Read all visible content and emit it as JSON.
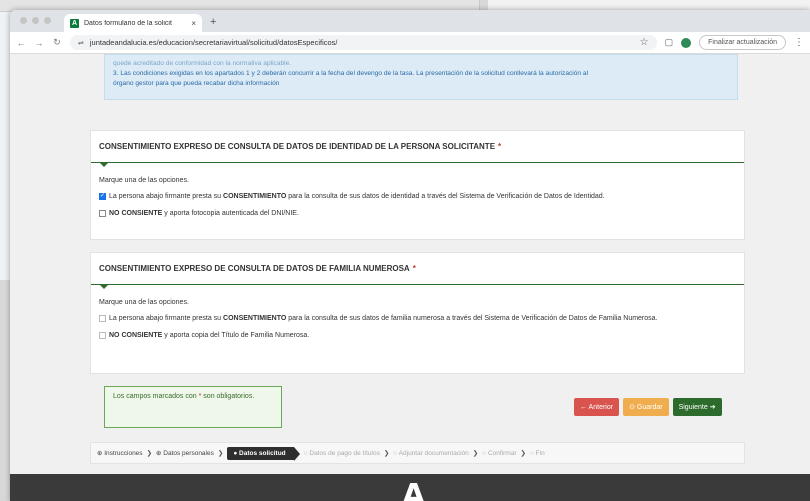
{
  "browser": {
    "tab_title": "Datos formulario de la solicit",
    "tab_close": "×",
    "new_tab": "+",
    "url": "juntadeandalucia.es/educacion/secretariavirtual/solicitud/datosEspecificos/",
    "update_button": "Finalizar actualización",
    "favicon": "A"
  },
  "info_box": {
    "line_cut": "quede acreditado de conformidad con la normativa aplicable.",
    "line_3": "3. Las condiciones exigidas en los apartados 1 y 2 deberán concurrir a la fecha del devengo de la tasa. La presentación de la solicitud conllevará la autorización al",
    "line_4": "órgano gestor para que pueda recabar dicha información"
  },
  "identity_panel": {
    "title": "CONSENTIMIENTO EXPRESO DE CONSULTA DE DATOS DE IDENTIDAD DE LA PERSONA SOLICITANTE",
    "required_mark": "*",
    "hint": "Marque una de las opciones.",
    "option_consent_pre": "La persona abajo firmante presta su",
    "option_consent_bold": "CONSENTIMIENTO",
    "option_consent_post": "para la consulta de sus datos de identidad a través del Sistema de Verificación de Datos de Identidad.",
    "option_consent_checked": true,
    "option_deny_bold": "NO CONSIENTE",
    "option_deny_post": "y aporta fotocopia autenticada del DNI/NIE."
  },
  "family_panel": {
    "title": "CONSENTIMIENTO EXPRESO DE CONSULTA DE DATOS DE FAMILIA NUMEROSA",
    "required_mark": "*",
    "hint": "Marque una de las opciones.",
    "option_consent_pre": "La persona abajo firmante presta su",
    "option_consent_bold": "CONSENTIMIENTO",
    "option_consent_post": "para la consulta de sus datos de familia numerosa a través del Sistema de Verificación de Datos de Familia Numerosa.",
    "option_deny_bold": "NO CONSIENTE",
    "option_deny_post": "y aporta copia del Título de Familia Numerosa."
  },
  "required_note": {
    "text_pre": "Los campos marcados con",
    "star": "*",
    "text_post": "son obligatorios."
  },
  "buttons": {
    "prev": "← Anterior",
    "save": "⊙ Guardar",
    "next": "Siguiente ➔"
  },
  "steps": {
    "instructions": "⊕ Instrucciones",
    "personal": "⊕ Datos personales",
    "request": "● Datos solicitud",
    "payment": "○ Datos de pago de títulos",
    "attach": "○ Adjuntar documentación",
    "confirm": "○ Confirmar",
    "end": "○ Fin",
    "separator": "❯"
  },
  "footer": {
    "logo": "A"
  },
  "colors": {
    "accent_green": "#2d6b2d",
    "danger": "#d9534f",
    "warning": "#f0ad4e",
    "info_bg": "#dcebf6"
  }
}
